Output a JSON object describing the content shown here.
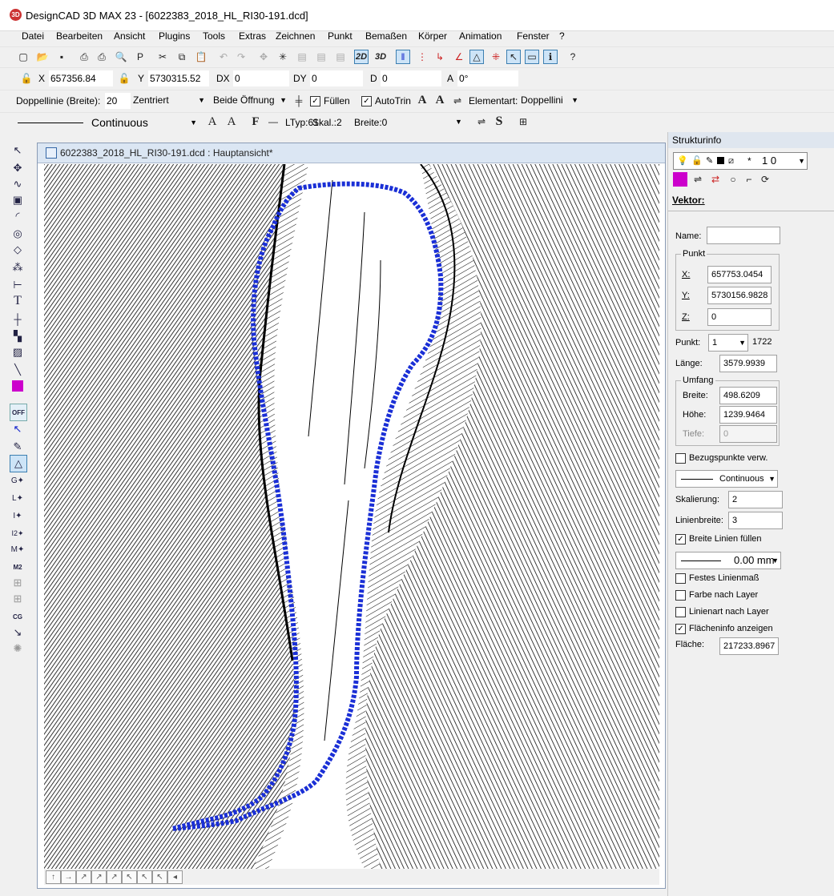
{
  "window": {
    "title": "DesignCAD 3D MAX 23 - [6022383_2018_HL_RI30-191.dcd]",
    "app_icon": "3D"
  },
  "menu": [
    "Datei",
    "Bearbeiten",
    "Ansicht",
    "Plugins",
    "Tools",
    "Extras",
    "Zeichnen",
    "Punkt",
    "Bemaßen",
    "Körper",
    "Animation",
    "Fenster",
    "?"
  ],
  "coords": {
    "x_label": "X",
    "x_value": "657356.84",
    "y_label": "Y",
    "y_value": "5730315.52",
    "dx_label": "DX",
    "dx_value": "0",
    "dy_label": "DY",
    "dy_value": "0",
    "d_label": "D",
    "d_value": "0",
    "a_label": "A",
    "a_value": "0°"
  },
  "toolbar_row1": {
    "view2d": "2D",
    "view3d": "3D"
  },
  "doubleline": {
    "label": "Doppellinie (Breite):",
    "value": "20",
    "align": "Zentriert",
    "opening": "Beide Öffnung",
    "fill_label": "Füllen",
    "autotrim_label": "AutoTrin",
    "elementart_label": "Elementart:",
    "elementart_value": "Doppellini"
  },
  "linestyle": {
    "linetype": "Continuous",
    "ltyp": "LTyp:61",
    "skal": "Skal.:2",
    "breite": "Breite:0"
  },
  "document": {
    "title": "6022383_2018_HL_RI30-191.dcd : Hauptansicht*"
  },
  "left_tools": {
    "off_label": "OFF"
  },
  "colors": {
    "selection": "#1a2fd6",
    "magenta": "#cc00cc",
    "accent": "#3c7fb1"
  },
  "panel": {
    "title": "Strukturinfo",
    "layer_text": "*",
    "layer_num": "1 0",
    "vektor_label": "Vektor:",
    "name_label": "Name:",
    "name_value": "",
    "punkt_group": "Punkt",
    "x_label": "X:",
    "x_value": "657753.0454",
    "y_label": "Y:",
    "y_value": "5730156.9828",
    "z_label": "Z:",
    "z_value": "0",
    "punkt_label": "Punkt:",
    "punkt_value": "1",
    "punkt_count": "1722",
    "laenge_label": "Länge:",
    "laenge_value": "3579.9939",
    "umfang_group": "Umfang",
    "breite_label": "Breite:",
    "breite_value": "498.6209",
    "hoehe_label": "Höhe:",
    "hoehe_value": "1239.9464",
    "tiefe_label": "Tiefe:",
    "tiefe_value": "0",
    "bezug_label": "Bezugspunkte verw.",
    "linetype": "Continuous",
    "skal_label": "Skalierung:",
    "skal_value": "2",
    "linienbreite_label": "Linienbreite:",
    "linienbreite_value": "3",
    "breite_fuellen_label": "Breite Linien füllen",
    "mm_value": "0.00 mm",
    "festes_label": "Festes Linienmaß",
    "farbe_label": "Farbe nach Layer",
    "linienart_label": "Linienart nach Layer",
    "flaeche_info_label": "Flächeninfo anzeigen",
    "flaeche_label": "Fläche:",
    "flaeche_value": "217233.8967"
  }
}
